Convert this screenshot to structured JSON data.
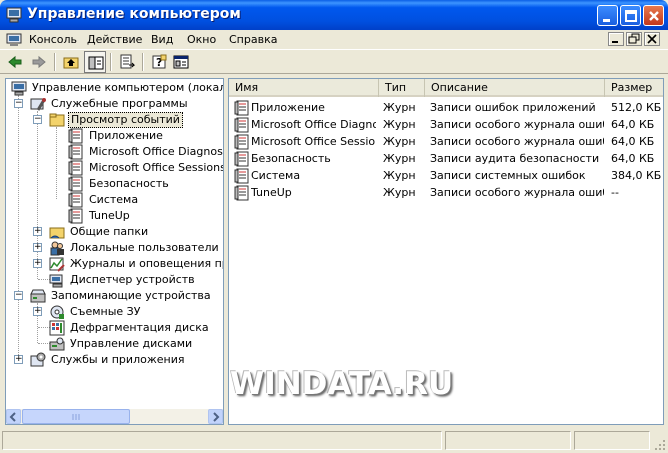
{
  "window": {
    "title": "Управление компьютером",
    "icon": "computer-management-icon"
  },
  "menu": [
    "Консоль",
    "Действие",
    "Вид",
    "Окно",
    "Справка"
  ],
  "toolbar": {
    "buttons": [
      "back-arrow-icon",
      "forward-arrow-icon",
      "up-folder-icon",
      "show-hide-tree-icon",
      "export-list-icon",
      "help-icon",
      "properties-icon"
    ]
  },
  "tree": {
    "root": "Управление компьютером (локальным)",
    "system_tools": "Служебные программы",
    "event_viewer": "Просмотр событий",
    "events": [
      "Приложение",
      "Microsoft Office Diagnostics",
      "Microsoft Office Sessions",
      "Безопасность",
      "Система",
      "TuneUp"
    ],
    "shared_folders": "Общие папки",
    "local_users": "Локальные пользователи и группы",
    "perf_logs": "Журналы и оповещения производительности",
    "device_manager": "Диспетчер устройств",
    "storage": "Запоминающие устройства",
    "removable": "Съемные ЗУ",
    "defrag": "Дефрагментация диска",
    "disk_mgmt": "Управление дисками",
    "services": "Службы и приложения"
  },
  "list": {
    "headers": [
      "Имя",
      "Тип",
      "Описание",
      "Размер"
    ],
    "rows": [
      {
        "name": "Приложение",
        "type": "Журн",
        "desc": "Записи ошибок приложений",
        "size": "512,0 КБ"
      },
      {
        "name": "Microsoft Office Diagnostics",
        "type": "Журн",
        "desc": "Записи особого журнала ошибок",
        "size": "64,0 КБ"
      },
      {
        "name": "Microsoft Office Sessions",
        "type": "Журн",
        "desc": "Записи особого журнала ошибок",
        "size": "64,0 КБ"
      },
      {
        "name": "Безопасность",
        "type": "Журн",
        "desc": "Записи аудита безопасности",
        "size": "64,0 КБ"
      },
      {
        "name": "Система",
        "type": "Журн",
        "desc": "Записи системных ошибок",
        "size": "384,0 КБ"
      },
      {
        "name": "TuneUp",
        "type": "Журн",
        "desc": "Записи особого журнала ошибок",
        "size": "--"
      }
    ]
  },
  "watermark": "WINDATA.RU"
}
